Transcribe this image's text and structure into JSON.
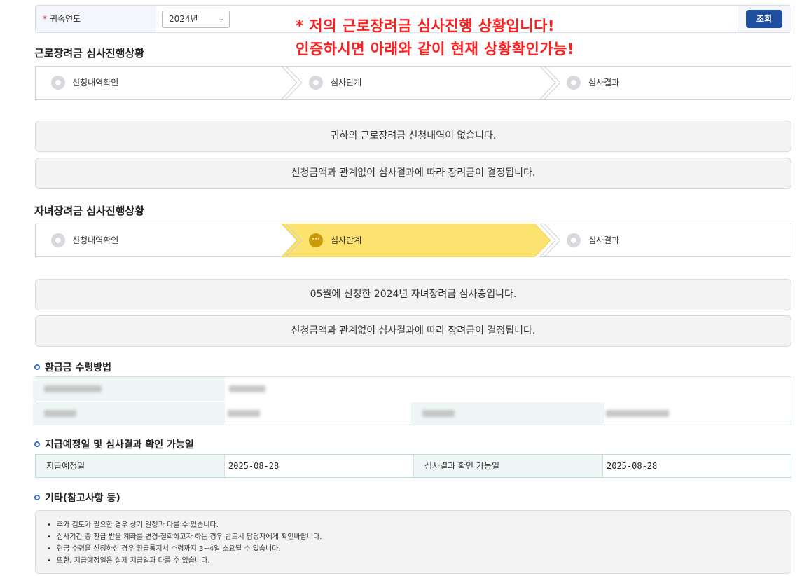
{
  "search": {
    "required_mark": "*",
    "year_label": "귀속연도",
    "year_value": "2024년",
    "button_label": "조회"
  },
  "overlay": {
    "line1": "* 저의 근로장려금 심사진행 상황입니다!",
    "line2": "인증하시면 아래와 같이 현재 상황확인가능!"
  },
  "work_incentive": {
    "title": "근로장려금 심사진행상황",
    "steps": [
      {
        "label": "신청내역확인",
        "state": "inactive"
      },
      {
        "label": "심사단계",
        "state": "inactive"
      },
      {
        "label": "심사결과",
        "state": "inactive"
      }
    ],
    "messages": [
      "귀하의 근로장려금 신청내역이 없습니다.",
      "신청금액과 관계없이 심사결과에 따라 장려금이 결정됩니다."
    ]
  },
  "child_incentive": {
    "title": "자녀장려금 심사진행상황",
    "steps": [
      {
        "label": "신청내역확인",
        "state": "inactive"
      },
      {
        "label": "심사단계",
        "state": "active"
      },
      {
        "label": "심사결과",
        "state": "inactive"
      }
    ],
    "active_icon": "···",
    "messages": [
      "05월에 신청한 2024년 자녀장려금 심사중입니다.",
      "신청금액과 관계없이 심사결과에 따라 장려금이 결정됩니다."
    ]
  },
  "refund": {
    "title": "환급금 수령방법"
  },
  "payment": {
    "title": "지급예정일 및 심사결과 확인 가능일",
    "scheduled_label": "지급예정일",
    "scheduled_value": "2025-08-28",
    "result_label": "심사결과 확인 가능일",
    "result_value": "2025-08-28"
  },
  "other": {
    "title": "기타(참고사항 등)",
    "notes": [
      "추가 검토가 필요한 경우 상기 일정과 다를 수 있습니다.",
      "심사기간 중 환급 받을 계좌를 변경·철회하고자 하는 경우 반드시 담당자에게 확인바랍니다.",
      "현금 수령을 신청하신 경우 환급통지서 수령까지 3~4일 소요될 수 있습니다.",
      "또한, 지급예정일은 실제 지급일과 다를 수 있습니다."
    ]
  },
  "colors": {
    "accent_blue": "#1f4f9f",
    "active_step": "#fce26e",
    "overlay_red": "#ff1f1f"
  }
}
